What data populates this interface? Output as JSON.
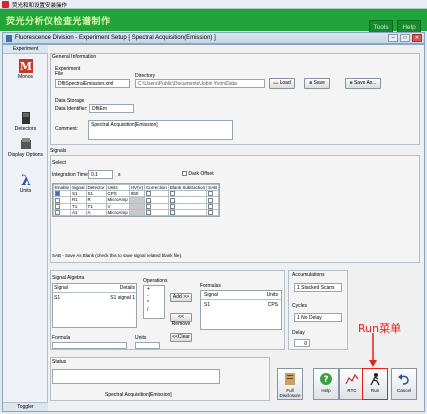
{
  "os_title": "荧光和和设置安装操作",
  "green_bar": {
    "title": "荧光分析仪检查光谱制作",
    "tools_label": "Tools",
    "help_label": "Help"
  },
  "window": {
    "title": "Fluorescence Division - Experiment Setup [ Spectral Acquisition(Emission) ]"
  },
  "sidebar": {
    "tab": "Experiment",
    "items": [
      {
        "label": "Monos"
      },
      {
        "label": "Detectors"
      },
      {
        "label": "Display Options"
      },
      {
        "label": "Units"
      }
    ],
    "toggler": "Toggler"
  },
  "general": {
    "title": "General Information",
    "experiment_label": "Experiment",
    "file_label": "File",
    "directory_label": "Directory",
    "file_value": "DfltSpectralEmission.xml",
    "directory_value": "C:\\Users\\Public\\Documents\\Jobin Yvon\\Data",
    "load_label": "Load",
    "save_label": "Save",
    "save_as_label": "Save As...",
    "data_storage_label": "Data Storage",
    "data_identifier_label": "Data Identifier:",
    "data_identifier_value": "DfltEm",
    "comment_label": "Comment:",
    "comment_value": "Spectral Acquisition[Emission]"
  },
  "signals": {
    "title": "Signals",
    "select_label": "Select",
    "integration_label": "Integration Time:",
    "integration_value": "0.1",
    "integration_unit": "s",
    "dark_offset_label": "Dark Offset",
    "headers": [
      "Enable",
      "Signal",
      "Detector",
      "Units",
      "HV(V)",
      "Correction",
      "Blank Subtraction",
      "SAB"
    ],
    "rows": [
      {
        "enable": true,
        "signal": "S1",
        "detector": "S1",
        "units": "CPS",
        "hv": "950"
      },
      {
        "enable": false,
        "signal": "R1",
        "detector": "R",
        "units": "MicroAmp",
        "hv": ""
      },
      {
        "enable": false,
        "signal": "T1",
        "detector": "T1",
        "units": "V",
        "hv": ""
      },
      {
        "enable": false,
        "signal": "A1",
        "detector": "A",
        "units": "MicroAmp",
        "hv": ""
      }
    ],
    "sab_note": "SAB - Save As Blank (check this to save signal related blank file)."
  },
  "algebra": {
    "title": "Signal Algebra",
    "signal_header": "Signal",
    "details_header": "Details",
    "row_signal": "S1",
    "row_details": "S1 signal 1",
    "operations_label": "Operations",
    "operations": [
      "+",
      "-",
      "*",
      "/"
    ],
    "add_label": "Add >>",
    "remove_label": "<< Remove",
    "clear_label": "<<Clear",
    "formulas_label": "Formulas",
    "f_signal_header": "Signal",
    "f_units_header": "Units",
    "f_row_signal": "S1",
    "f_row_units": "CPS",
    "formula_label": "Formula",
    "units_label": "Units"
  },
  "accumulations": {
    "title": "Accumulations",
    "count": "1",
    "mode": "Stacked Scans",
    "cycles_title": "Cycles",
    "cycles_count": "1",
    "cycles_mode": "No Delay",
    "delay_label": "Delay",
    "delay_value": "0"
  },
  "status": {
    "title": "Status",
    "experiment_name": "Spectral Acquisition[Emission]"
  },
  "actions": {
    "full_disclosure": "Full Disclosure",
    "help": "Help",
    "rtc": "RTC",
    "run": "Run",
    "cancel": "Cancel"
  },
  "annotation": {
    "text": "Run菜单",
    "color": "#e8201b"
  }
}
